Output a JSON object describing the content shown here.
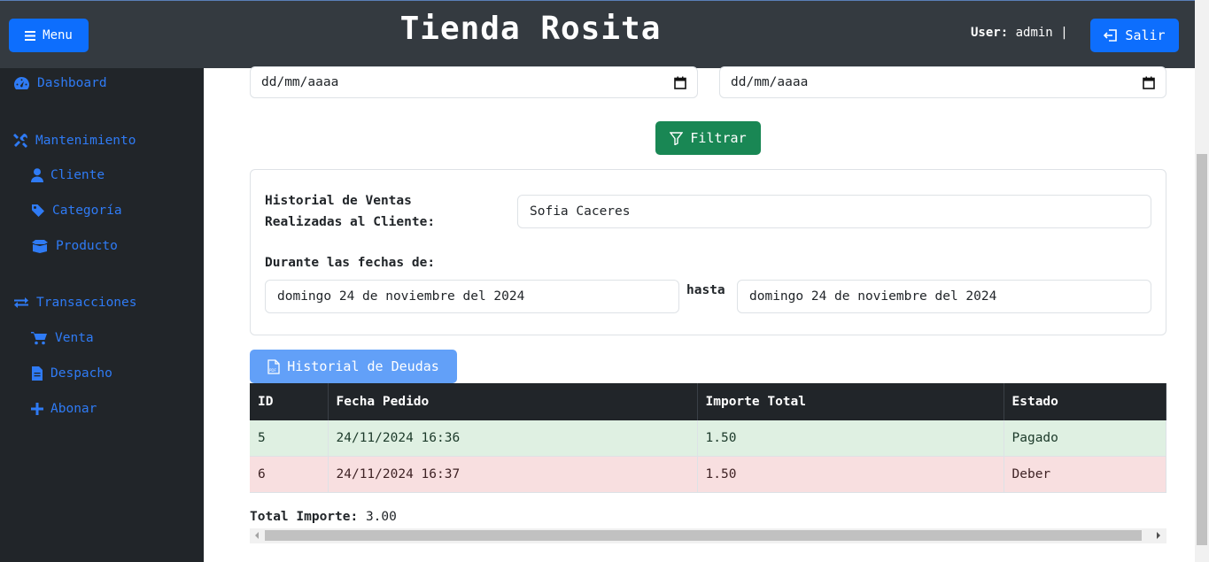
{
  "header": {
    "menu_label": "Menu",
    "title": "Tienda Rosita",
    "user_label": "User:",
    "user_name": "admin",
    "separator": "|",
    "logout_label": "Salir"
  },
  "sidebar": {
    "items": [
      {
        "label": "Dashboard",
        "icon": "dashboard-icon"
      },
      {
        "label": "Mantenimiento",
        "icon": "tools-icon"
      },
      {
        "label": "Cliente",
        "icon": "user-icon"
      },
      {
        "label": "Categoría",
        "icon": "tag-icon"
      },
      {
        "label": "Producto",
        "icon": "boxes-icon"
      },
      {
        "label": "Transacciones",
        "icon": "exchange-icon"
      },
      {
        "label": "Venta",
        "icon": "cart-icon"
      },
      {
        "label": "Despacho",
        "icon": "file-icon"
      },
      {
        "label": "Abonar",
        "icon": "plus-icon"
      }
    ]
  },
  "filters": {
    "date_from_placeholder": "dd/mm/aaaa",
    "date_to_placeholder": "dd/mm/aaaa",
    "filter_label": "Filtrar"
  },
  "summary": {
    "history_label_line1": "Historial de Ventas",
    "history_label_line2": "Realizadas al Cliente:",
    "client_name": "Sofia Caceres",
    "dates_label": "Durante las fechas de:",
    "date_start": "domingo 24 de noviembre del 2024",
    "until_label": "hasta",
    "date_end": "domingo 24 de noviembre del 2024"
  },
  "debt_button_label": "Historial de Deudas",
  "table": {
    "headers": [
      "ID",
      "Fecha Pedido",
      "Importe Total",
      "Estado"
    ],
    "rows": [
      {
        "id": "5",
        "fecha": "24/11/2024 16:36",
        "importe": "1.50",
        "estado": "Pagado"
      },
      {
        "id": "6",
        "fecha": "24/11/2024 16:37",
        "importe": "1.50",
        "estado": "Deber"
      }
    ]
  },
  "total": {
    "label": "Total Importe:",
    "value": "3.00"
  },
  "colors": {
    "primary": "#0d6efd",
    "success": "#198754",
    "sidebar_bg": "#212529",
    "topbar_bg": "#343a40",
    "row_paid": "#dff0e2",
    "row_debt": "#f8dfe0"
  }
}
